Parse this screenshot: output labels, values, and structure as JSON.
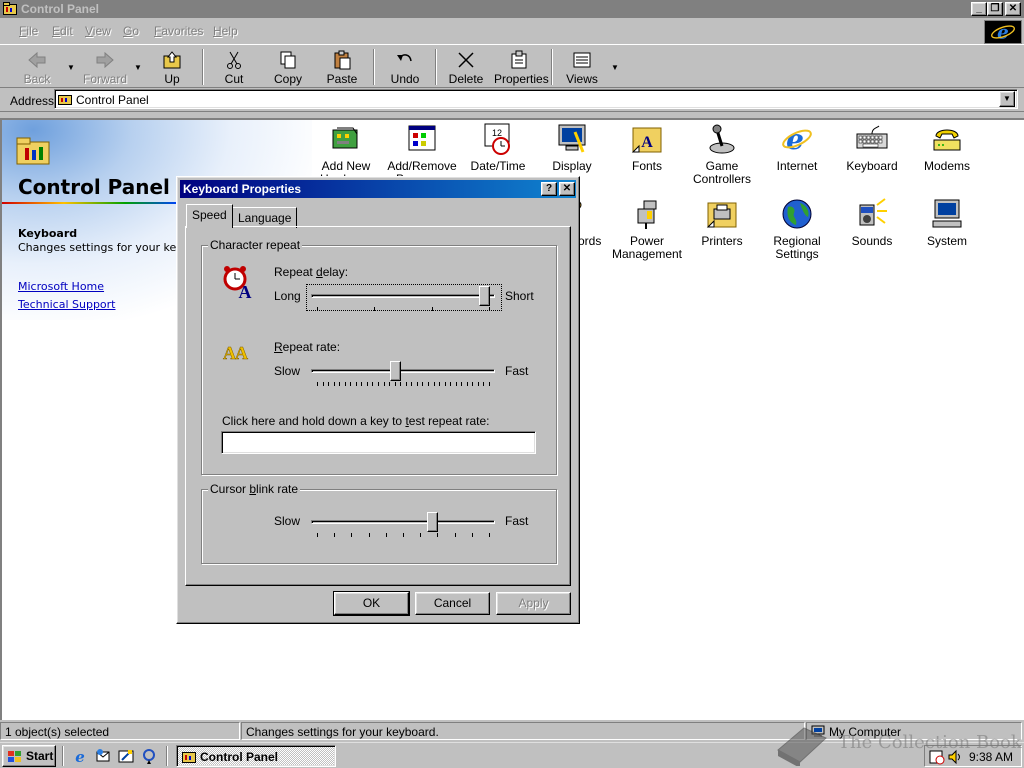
{
  "window": {
    "title": "Control Panel",
    "caption_minimize": "_",
    "caption_restore": "❐",
    "caption_close": "✕"
  },
  "menu": [
    {
      "label": "File",
      "key": "F",
      "rest": "ile"
    },
    {
      "label": "Edit",
      "key": "E",
      "rest": "dit"
    },
    {
      "label": "View",
      "key": "V",
      "rest": "iew"
    },
    {
      "label": "Go",
      "key": "G",
      "rest": "o"
    },
    {
      "label": "Favorites",
      "key": "F",
      "rest": "avorites"
    },
    {
      "label": "Help",
      "key": "H",
      "rest": "elp"
    }
  ],
  "toolbar": {
    "back": "Back",
    "forward": "Forward",
    "up": "Up",
    "cut": "Cut",
    "copy": "Copy",
    "paste": "Paste",
    "undo": "Undo",
    "delete": "Delete",
    "properties": "Properties",
    "views": "Views",
    "dropdown_glyph": "▼"
  },
  "address": {
    "label": "Address",
    "value": "Control Panel"
  },
  "sidebar": {
    "title": "Control Panel",
    "selected_title": "Keyboard",
    "selected_desc": "Changes settings for your keyboard.",
    "links": [
      "Microsoft Home",
      "Technical Support"
    ]
  },
  "icons": [
    {
      "label": "Add New Hardware",
      "name": "add-new-hardware"
    },
    {
      "label": "Add/Remove Programs",
      "name": "add-remove-programs"
    },
    {
      "label": "Date/Time",
      "name": "date-time"
    },
    {
      "label": "Display",
      "name": "display"
    },
    {
      "label": "Fonts",
      "name": "fonts"
    },
    {
      "label": "Game Controllers",
      "name": "game-controllers"
    },
    {
      "label": "Internet",
      "name": "internet"
    },
    {
      "label": "Keyboard",
      "name": "keyboard"
    },
    {
      "label": "Modems",
      "name": "modems"
    },
    {
      "label": "Passwords",
      "name": "passwords"
    },
    {
      "label": "Power Management",
      "name": "power-management"
    },
    {
      "label": "Printers",
      "name": "printers"
    },
    {
      "label": "Regional Settings",
      "name": "regional-settings"
    },
    {
      "label": "Sounds",
      "name": "sounds"
    },
    {
      "label": "System",
      "name": "system"
    }
  ],
  "status": {
    "selected": "1 object(s) selected",
    "description": "Changes settings for your keyboard.",
    "zone": "My Computer"
  },
  "taskbar": {
    "start": "Start",
    "task": "Control Panel",
    "clock": "9:38 AM"
  },
  "dialog": {
    "title": "Keyboard Properties",
    "help_btn": "?",
    "close_btn": "✕",
    "tabs": [
      "Speed",
      "Language"
    ],
    "char_repeat": {
      "group": "Character repeat",
      "delay_label": "Repeat delay:",
      "delay_key": "d",
      "delay_min": "Long",
      "delay_max": "Short",
      "delay_value": 1.0,
      "rate_label": "Repeat rate:",
      "rate_key": "R",
      "rate_min": "Slow",
      "rate_max": "Fast",
      "rate_value": 0.48,
      "test_label": "Click here and hold down a key to test repeat rate:",
      "test_key": "t"
    },
    "cursor_blink": {
      "group": "Cursor blink rate",
      "group_key": "b",
      "min": "Slow",
      "max": "Fast",
      "value": 0.7
    },
    "buttons": {
      "ok": "OK",
      "cancel": "Cancel",
      "apply": "Apply"
    }
  },
  "watermark": {
    "text": "The Collection Book"
  },
  "colors": {
    "desktop_gray": "#c0c0c0",
    "active_title": "#000080",
    "active_title_end": "#1084d0",
    "inactive_title": "#808080",
    "link": "#0000c0"
  }
}
